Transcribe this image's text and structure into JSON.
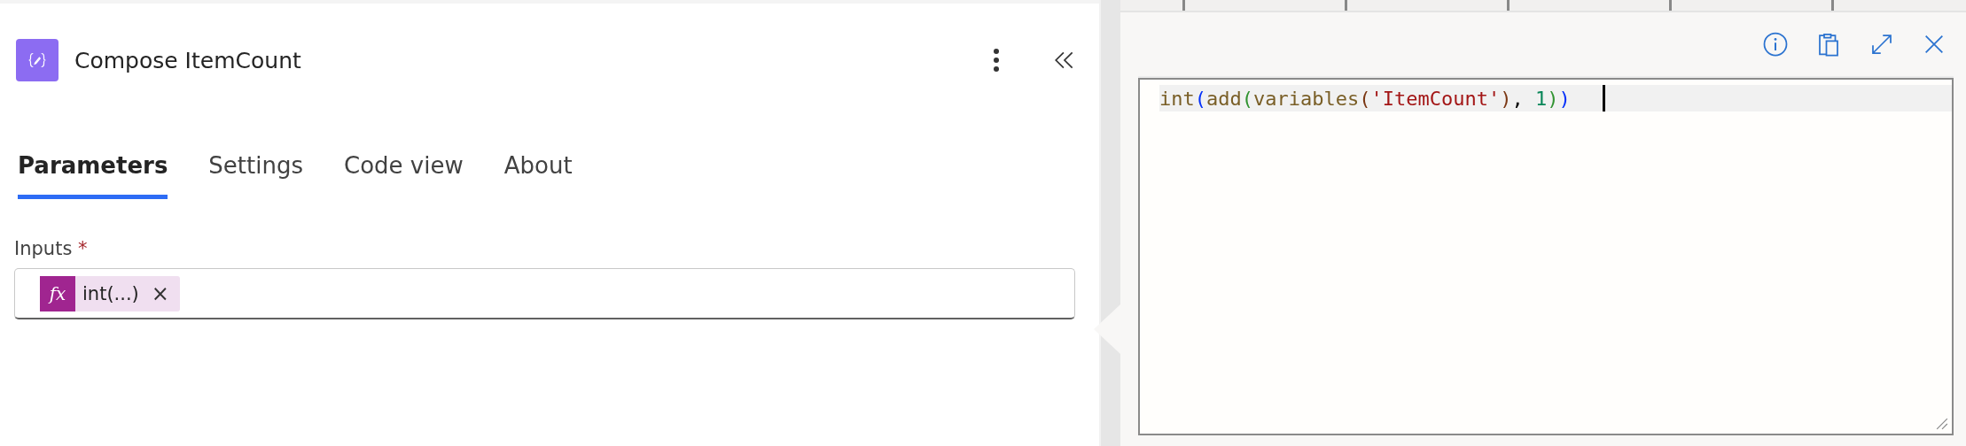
{
  "action": {
    "title": "Compose ItemCount"
  },
  "tabs": [
    {
      "label": "Parameters",
      "selected": true
    },
    {
      "label": "Settings",
      "selected": false
    },
    {
      "label": "Code view",
      "selected": false
    },
    {
      "label": "About",
      "selected": false
    }
  ],
  "inputs": {
    "label": "Inputs",
    "required_mark": "*",
    "token": {
      "icon": "fx",
      "text": "int(...)",
      "remove": "×"
    }
  },
  "expression_editor": {
    "code_tokens": [
      {
        "text": "int",
        "color": "#795e26"
      },
      {
        "text": "(",
        "color": "#0431fa"
      },
      {
        "text": "add",
        "color": "#795e26"
      },
      {
        "text": "(",
        "color": "#319331"
      },
      {
        "text": "variables",
        "color": "#795e26"
      },
      {
        "text": "(",
        "color": "#7b3814"
      },
      {
        "text": "'ItemCount'",
        "color": "#a31515"
      },
      {
        "text": ")",
        "color": "#7b3814"
      },
      {
        "text": ", ",
        "color": "#000000"
      },
      {
        "text": "1",
        "color": "#098658"
      },
      {
        "text": ")",
        "color": "#319331"
      },
      {
        "text": ")",
        "color": "#0431fa"
      }
    ]
  }
}
